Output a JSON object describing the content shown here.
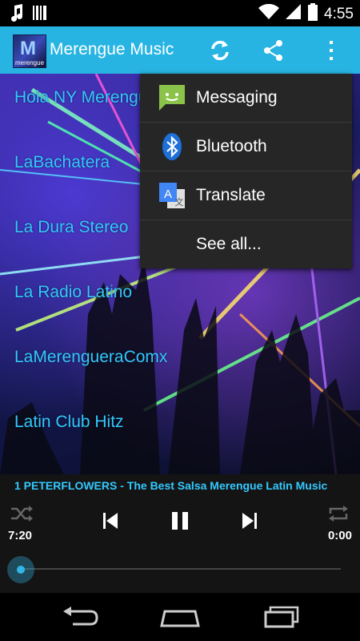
{
  "app": {
    "title": "Merengue Music",
    "logo_caption": "merengue",
    "logo_mark": "M"
  },
  "status_bar": {
    "time": "4:55",
    "icons": [
      "music-note-icon",
      "barcode-icon",
      "wifi-icon",
      "signal-icon",
      "battery-icon"
    ]
  },
  "action_bar": {
    "icons": [
      "refresh-icon",
      "share-icon",
      "overflow-menu-icon"
    ]
  },
  "stations": [
    {
      "label": "Hola NY Merengue"
    },
    {
      "label": "LaBachatera"
    },
    {
      "label": "La Dura Stereo"
    },
    {
      "label": "La Radio Latino"
    },
    {
      "label": "LaMerengueraComx"
    },
    {
      "label": "Latin Club Hitz"
    }
  ],
  "share_menu": {
    "items": [
      {
        "label": "Messaging",
        "icon": "messaging-icon"
      },
      {
        "label": "Bluetooth",
        "icon": "bluetooth-icon"
      },
      {
        "label": "Translate",
        "icon": "translate-icon"
      },
      {
        "label": "See all...",
        "icon": ""
      }
    ]
  },
  "player": {
    "now_playing": "1 PETERFLOWERS - The Best Salsa Merengue Latin Music",
    "elapsed": "7:20",
    "total": "0:00",
    "progress": 0.0
  },
  "colors": {
    "accent": "#27b4e3",
    "link": "#33c9ff",
    "menu_bg": "#262626"
  }
}
